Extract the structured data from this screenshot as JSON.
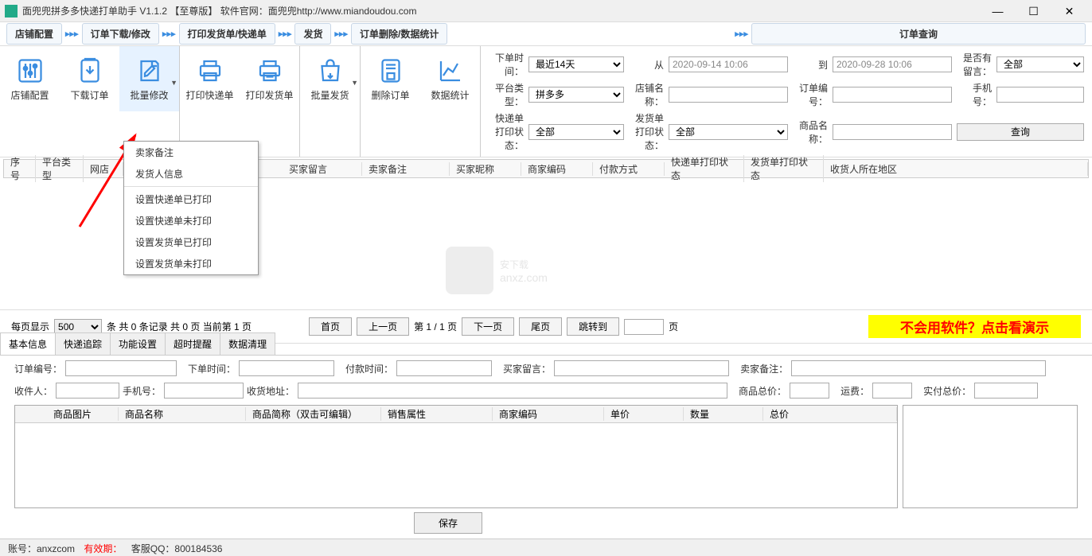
{
  "window": {
    "title": "面兜兜拼多多快递打单助手  V1.1.2 【至尊版】    软件官网：面兜兜http://www.miandoudou.com"
  },
  "steps": {
    "s1": "店铺配置",
    "s2": "订单下载/修改",
    "s3": "打印发货单/快递单",
    "s4": "发货",
    "s5": "订单删除/数据统计",
    "s6": "订单查询"
  },
  "toolbar": {
    "t1": "店铺配置",
    "t2": "下载订单",
    "t3": "批量修改",
    "t4": "打印快递单",
    "t5": "打印发货单",
    "t6": "批量发货",
    "t7": "删除订单",
    "t8": "数据统计"
  },
  "filters": {
    "l_time": "下单时间：",
    "v_time": "最近14天",
    "l_from": "从",
    "v_from": "2020-09-14 10:06",
    "l_to": "到",
    "v_to": "2020-09-28 10:06",
    "l_remark": "是否有留言：",
    "v_remark": "全部",
    "l_plat": "平台类型：",
    "v_plat": "拼多多",
    "l_shop": "店铺名称：",
    "l_order": "订单编号：",
    "l_phone": "手机号：",
    "l_exp": "快递单打印状态：",
    "v_exp": "全部",
    "l_ship": "发货单打印状态：",
    "v_ship": "全部",
    "l_goods": "商品名称：",
    "btn_query": "查询"
  },
  "columns": {
    "c1": "序号",
    "c2": "平台类型",
    "c3": "网店",
    "c4": "买家留言",
    "c5": "卖家备注",
    "c6": "买家昵称",
    "c7": "商家编码",
    "c8": "付款方式",
    "c9": "快递单打印状态",
    "c10": "发货单打印状态",
    "c11": "收货人所在地区"
  },
  "menu": {
    "m1": "卖家备注",
    "m2": "发货人信息",
    "m3": "设置快递单已打印",
    "m4": "设置快递单未打印",
    "m5": "设置发货单已打印",
    "m6": "设置发货单未打印"
  },
  "watermark": {
    "line1": "安下载",
    "line2": "anxz.com"
  },
  "pager": {
    "l1": "每页显示",
    "v1": "500",
    "l2": "条    共  0  条记录    共 0 页    当前第  1  页",
    "b1": "首页",
    "b2": "上一页",
    "mid": "第 1 /  1  页",
    "b3": "下一页",
    "b4": "尾页",
    "b5": "跳转到",
    "l3": "页",
    "help": "不会用软件？点击看演示"
  },
  "tabs": {
    "t1": "基本信息",
    "t2": "快递追踪",
    "t3": "功能设置",
    "t4": "超时提醒",
    "t5": "数据清理"
  },
  "detail": {
    "l_order": "订单编号：",
    "l_time": "下单时间：",
    "l_pay": "付款时间：",
    "l_buyermsg": "买家留言：",
    "l_sellermsg": "卖家备注：",
    "l_recv": "收件人：",
    "l_phone": "手机号：",
    "l_addr": "收货地址：",
    "l_total": "商品总价：",
    "l_ship": "运费：",
    "l_real": "实付总价：",
    "h1": "商品图片",
    "h2": "商品名称",
    "h3": "商品简称（双击可编辑）",
    "h4": "销售属性",
    "h5": "商家编码",
    "h6": "单价",
    "h7": "数量",
    "h8": "总价",
    "save": "保存"
  },
  "status": {
    "acct": "账号：anxzcom",
    "expire": "有效期：",
    "qq": "客服QQ：800184536"
  }
}
